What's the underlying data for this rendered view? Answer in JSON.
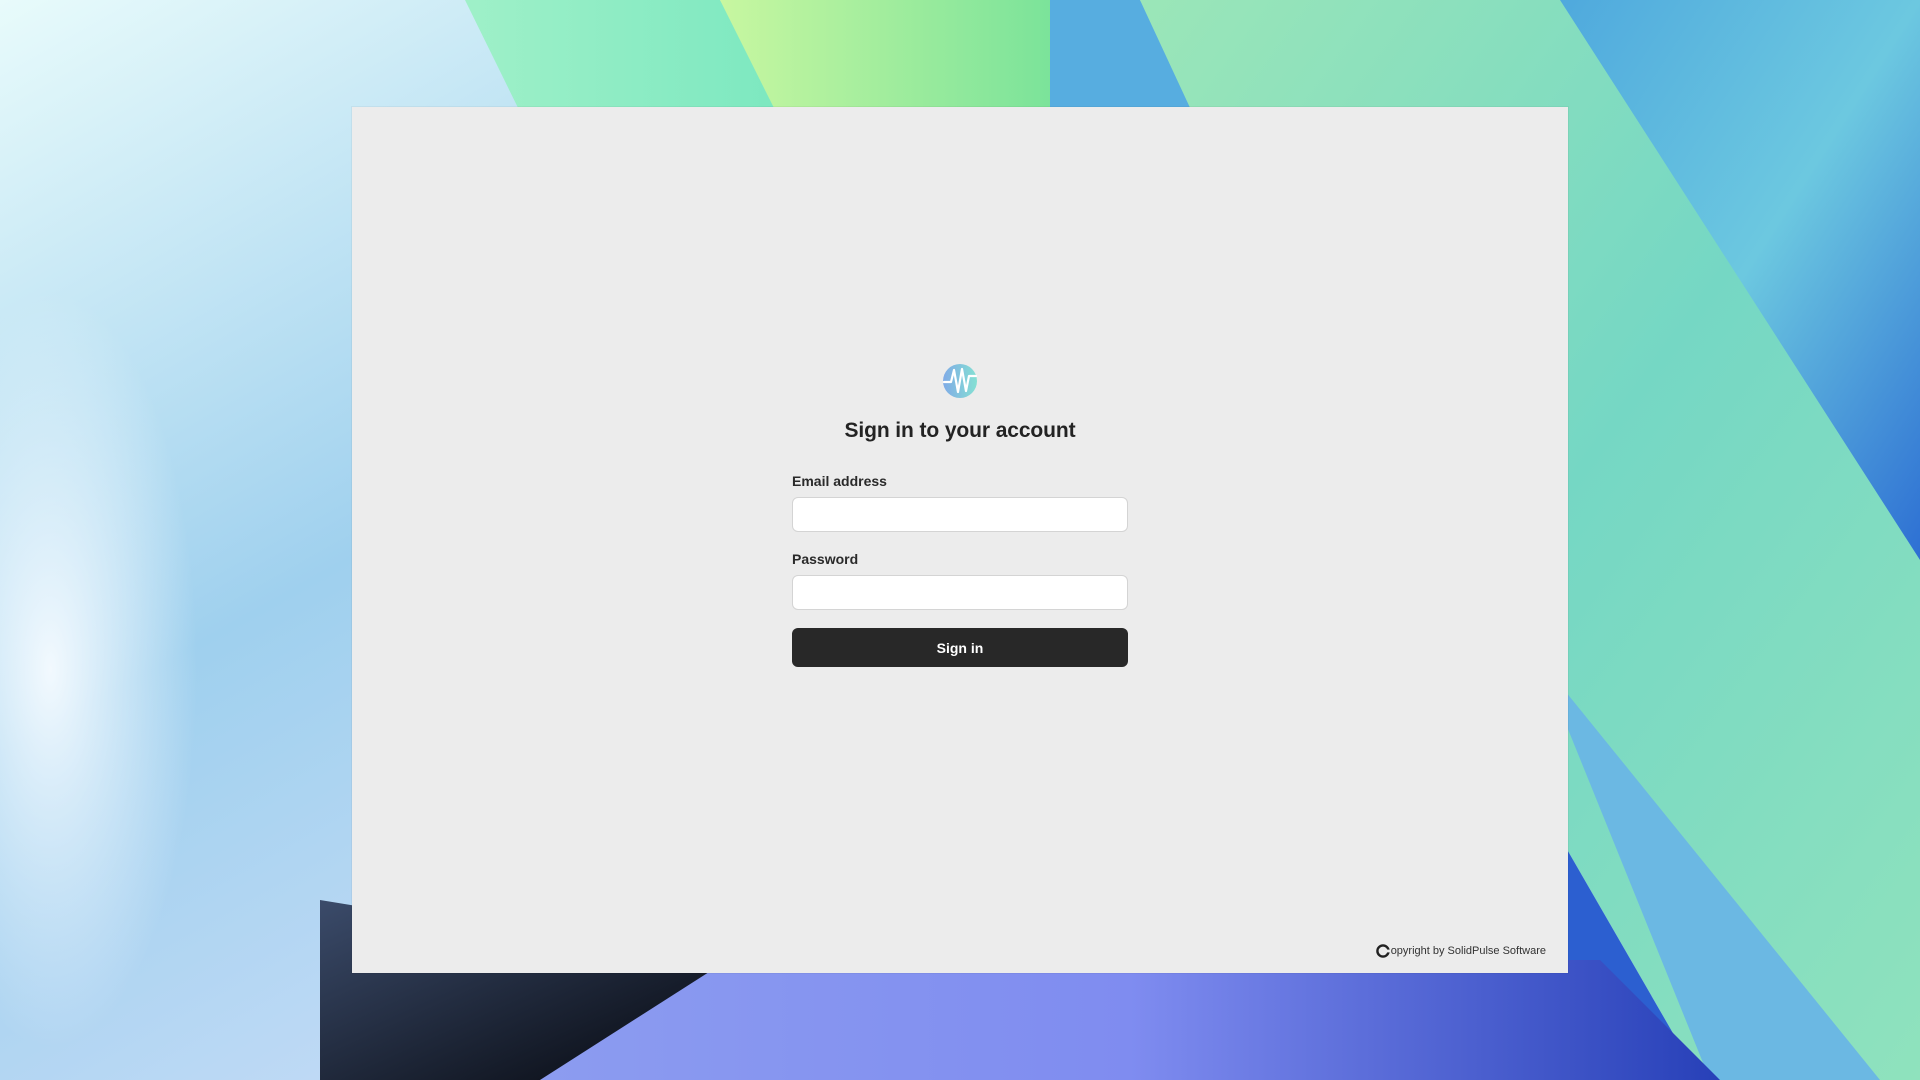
{
  "login": {
    "title": "Sign in to your account",
    "email_label": "Email address",
    "email_value": "",
    "email_placeholder": "",
    "password_label": "Password",
    "password_value": "",
    "password_placeholder": "",
    "signin_label": "Sign in",
    "logo_icon": "waveform-logo-icon"
  },
  "footer": {
    "copyright_icon": "copyright-icon",
    "copyright_text": "opyright by SolidPulse Software"
  },
  "colors": {
    "window_background": "#ececec",
    "button_background": "#282828",
    "button_text": "#ffffff",
    "title_text": "#232323"
  }
}
